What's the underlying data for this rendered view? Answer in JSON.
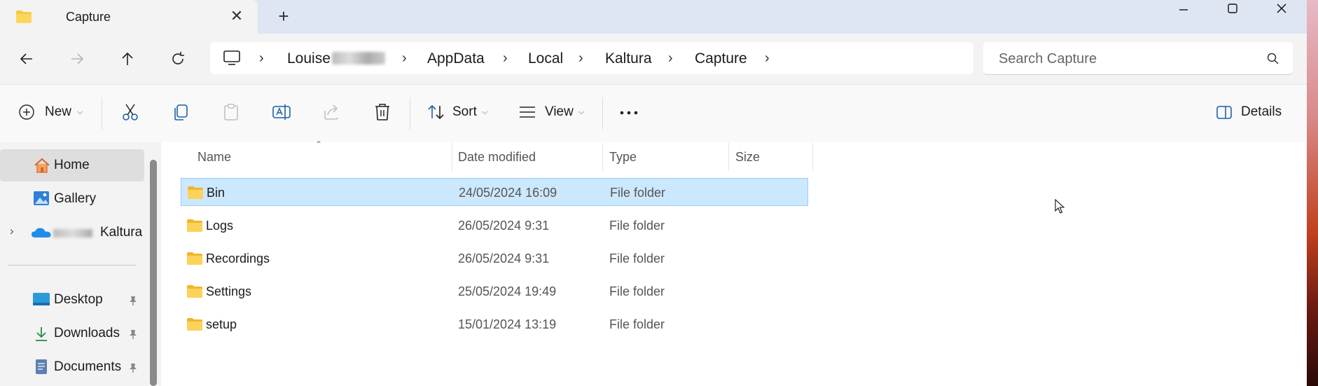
{
  "window": {
    "tab_title": "Capture",
    "new_tab": "+",
    "close_tab": "✕"
  },
  "address": {
    "crumbs": [
      "Louise",
      "AppData",
      "Local",
      "Kaltura",
      "Capture"
    ],
    "search_placeholder": "Search Capture"
  },
  "toolbar": {
    "new_label": "New",
    "sort_label": "Sort",
    "view_label": "View",
    "details_label": "Details"
  },
  "sidebar": {
    "items": [
      {
        "label": "Home",
        "icon": "home-icon"
      },
      {
        "label": "Gallery",
        "icon": "gallery-icon"
      },
      {
        "label": "Kaltura",
        "icon": "onedrive-icon"
      }
    ],
    "pinned": [
      {
        "label": "Desktop",
        "icon": "desktop-folder-icon"
      },
      {
        "label": "Downloads",
        "icon": "downloads-icon"
      },
      {
        "label": "Documents",
        "icon": "documents-icon"
      }
    ]
  },
  "columns": [
    "Name",
    "Date modified",
    "Type",
    "Size"
  ],
  "files": [
    {
      "name": "Bin",
      "date": "24/05/2024 16:09",
      "type": "File folder",
      "size": "",
      "selected": true
    },
    {
      "name": "Logs",
      "date": "26/05/2024 9:31",
      "type": "File folder",
      "size": "",
      "selected": false
    },
    {
      "name": "Recordings",
      "date": "26/05/2024 9:31",
      "type": "File folder",
      "size": "",
      "selected": false
    },
    {
      "name": "Settings",
      "date": "25/05/2024 19:49",
      "type": "File folder",
      "size": "",
      "selected": false
    },
    {
      "name": "setup",
      "date": "15/01/2024 13:19",
      "type": "File folder",
      "size": "",
      "selected": false
    }
  ],
  "colors": {
    "accent": "#0067c0",
    "selection": "#cce8ff",
    "folder": "#f8c940"
  }
}
